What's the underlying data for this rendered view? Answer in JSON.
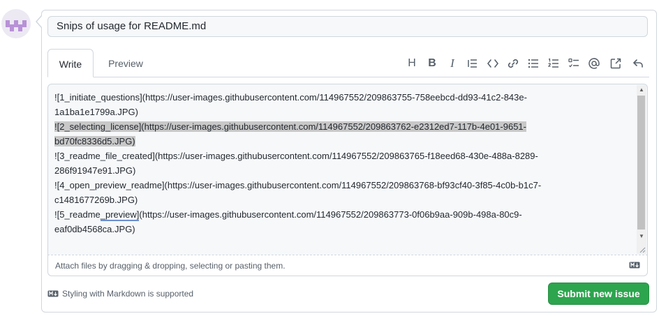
{
  "issue": {
    "title_value": "Snips of usage for README.md"
  },
  "tabs": [
    {
      "label": "Write",
      "active": true
    },
    {
      "label": "Preview",
      "active": false
    }
  ],
  "toolbar": {
    "buttons": [
      {
        "name": "heading",
        "icon": "heading-icon",
        "glyph": "H"
      },
      {
        "name": "bold",
        "icon": "bold-icon",
        "glyph": "B"
      },
      {
        "name": "italic",
        "icon": "italic-icon",
        "glyph": "I"
      },
      {
        "name": "quote",
        "icon": "quote-icon"
      },
      {
        "name": "code",
        "icon": "code-icon"
      },
      {
        "name": "link",
        "icon": "link-icon"
      },
      {
        "name": "unordered-list",
        "icon": "list-unordered-icon"
      },
      {
        "name": "ordered-list",
        "icon": "list-ordered-icon"
      },
      {
        "name": "task-list",
        "icon": "tasklist-icon"
      },
      {
        "name": "mention",
        "icon": "mention-icon"
      },
      {
        "name": "cross-reference",
        "icon": "cross-reference-icon"
      },
      {
        "name": "saved-replies",
        "icon": "reply-icon"
      }
    ]
  },
  "editor": {
    "lines": [
      {
        "segments": [
          {
            "text": "![1_initiate_questions](https://user-images.githubusercontent.com/114967552/209863755-758eebcd-dd93-41c2-843e-"
          }
        ]
      },
      {
        "segments": [
          {
            "text": "1a1ba1e1799a.JPG)"
          }
        ]
      },
      {
        "segments": [
          {
            "text": "![2_selecting_license](https://user-images.githubusercontent.com/114967552/209863762-e2312ed7-117b-4e01-9651-",
            "selected": true
          }
        ]
      },
      {
        "segments": [
          {
            "text": "bd70fc8336d5.JPG)",
            "selected": true
          }
        ]
      },
      {
        "segments": [
          {
            "text": "![3_readme_file_created](https://user-images.githubusercontent.com/114967552/209863765-f18eed68-430e-488a-8289-"
          }
        ]
      },
      {
        "segments": [
          {
            "text": "286f91947e91.JPG)"
          }
        ]
      },
      {
        "segments": [
          {
            "text": "![4_open_preview_readme](https://user-images.githubusercontent.com/114967552/209863768-bf93cf40-3f85-4c0b-b1c7-"
          }
        ]
      },
      {
        "segments": [
          {
            "text": "c1481677269b.JPG)"
          }
        ]
      },
      {
        "segments": [
          {
            "text": "![5_readme"
          },
          {
            "text": "_preview]",
            "spell": true
          },
          {
            "text": "(https://user-images.githubusercontent.com/114967552/209863773-0f06b9aa-909b-498a-80c9-"
          }
        ]
      },
      {
        "segments": [
          {
            "text": "eaf0db4568ca.JPG)"
          }
        ]
      }
    ]
  },
  "attach": {
    "text": "Attach files by dragging & dropping, selecting or pasting them."
  },
  "footer": {
    "markdown_note": "Styling with Markdown is supported",
    "submit_label": "Submit new issue"
  },
  "colors": {
    "submit_green": "#2da44e",
    "border": "#d0d7de",
    "avatar_purple": "#b891d7",
    "avatar_bg": "#ece9f3"
  }
}
